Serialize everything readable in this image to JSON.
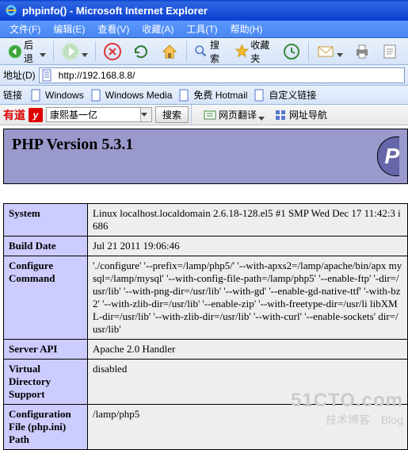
{
  "title": "phpinfo() - Microsoft Internet Explorer",
  "menu": [
    "文件(F)",
    "编辑(E)",
    "查看(V)",
    "收藏(A)",
    "工具(T)",
    "帮助(H)"
  ],
  "back_label": "后退",
  "search_label": "搜索",
  "fav_label": "收藏夹",
  "addr_label": "地址(D)",
  "url": "http://192.168.8.8/",
  "links_label": "链接",
  "links": [
    "Windows",
    "Windows Media",
    "免费 Hotmail",
    "自定义链接"
  ],
  "youdao": {
    "logo": "有道",
    "y": "y",
    "input_value": "康熙基一亿",
    "search_btn": "搜索",
    "translate": "网页翻译",
    "nav": "网址导航"
  },
  "php_version": "PHP Version 5.3.1",
  "php_logo": "P",
  "rows": [
    {
      "k": "System",
      "v": "Linux localhost.localdomain 2.6.18-128.el5 #1 SMP Wed Dec 17 11:42:3 i686"
    },
    {
      "k": "Build Date",
      "v": "Jul 21 2011 19:06:46"
    },
    {
      "k": "Configure Command",
      "v": "'./configure' '--prefix=/lamp/php5/' '--with-apxs2=/lamp/apache/bin/apx mysql=/lamp/mysql' '--with-config-file-path=/lamp/php5' '--enable-ftp' '-dir=/usr/lib' '--with-png-dir=/usr/lib' '--with-gd' '--enable-gd-native-ttf' '-with-bz2' '--with-zlib-dir=/usr/lib' '--enable-zip' '--with-freetype-dir=/usr/li libXML-dir=/usr/lib' '--with-zlib-dir=/usr/lib' '--with-curl' '--enable-sockets' dir=/usr/lib'"
    },
    {
      "k": "Server API",
      "v": "Apache 2.0 Handler"
    },
    {
      "k": "Virtual Directory Support",
      "v": "disabled"
    },
    {
      "k": "Configuration File (php.ini) Path",
      "v": "/lamp/php5"
    }
  ],
  "watermark": {
    "l1": "51CTO.com",
    "l2": "技术博客　Blog"
  }
}
